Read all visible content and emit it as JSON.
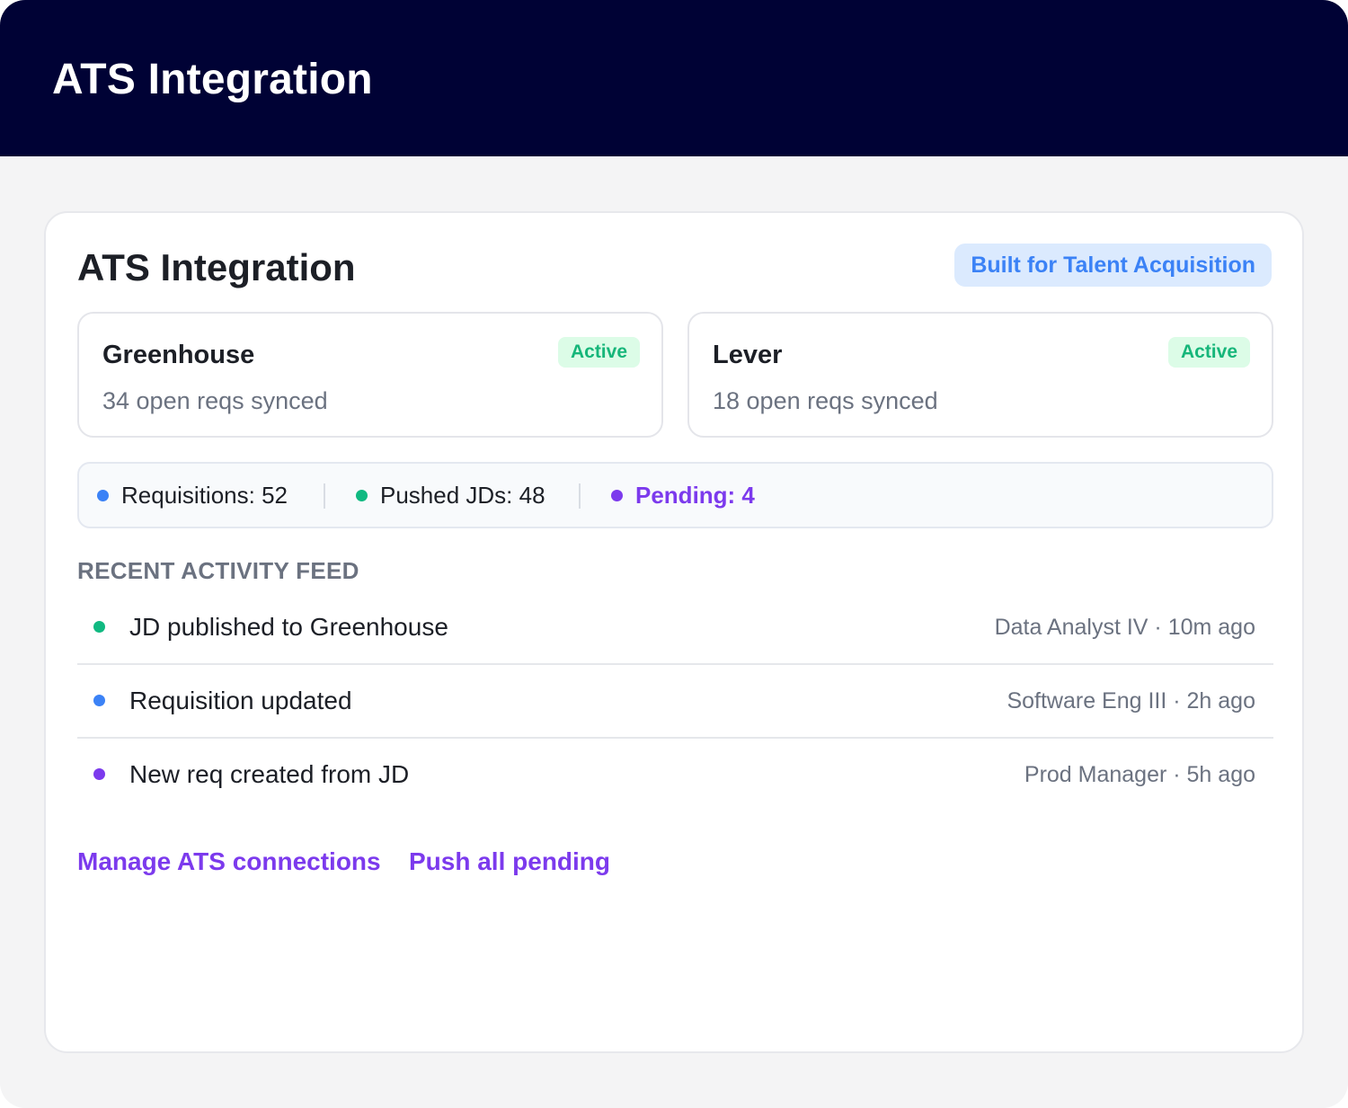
{
  "header": {
    "title": "ATS Integration"
  },
  "card": {
    "title": "ATS Integration",
    "badge": "Built for Talent Acquisition"
  },
  "integrations": [
    {
      "name": "Greenhouse",
      "status": "Active",
      "summary": "34 open reqs synced"
    },
    {
      "name": "Lever",
      "status": "Active",
      "summary": "18 open reqs synced"
    }
  ],
  "stats": [
    {
      "label": "Requisitions: 52",
      "color": "#3b82f6"
    },
    {
      "label": "Pushed JDs: 48",
      "color": "#10b981"
    },
    {
      "label": "Pending: 4",
      "color": "#7c3aed"
    }
  ],
  "feed": {
    "label": "RECENT ACTIVITY FEED",
    "items": [
      {
        "text": "JD published to Greenhouse",
        "meta": "Data Analyst IV · 10m ago",
        "color": "#10b981"
      },
      {
        "text": "Requisition updated",
        "meta": "Software Eng III · 2h ago",
        "color": "#3b82f6"
      },
      {
        "text": "New req created from JD",
        "meta": "Prod Manager · 5h ago",
        "color": "#7c3aed"
      }
    ]
  },
  "actions": {
    "manage": "Manage ATS connections",
    "push": "Push all pending"
  },
  "colors": {
    "header_bg": "#000235",
    "accent_purple": "#7c3aed",
    "accent_blue": "#3b82f6",
    "accent_green": "#10b981"
  }
}
